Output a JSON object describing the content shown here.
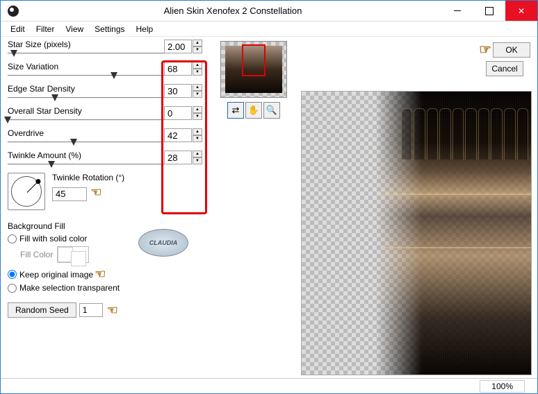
{
  "window": {
    "title": "Alien Skin Xenofex 2 Constellation"
  },
  "menu": {
    "edit": "Edit",
    "filter": "Filter",
    "view": "View",
    "settings": "Settings",
    "help": "Help"
  },
  "params": {
    "star_size": {
      "label": "Star Size (pixels)",
      "value": "2.00",
      "pos": 4
    },
    "size_var": {
      "label": "Size Variation",
      "value": "68",
      "pos": 68
    },
    "edge_density": {
      "label": "Edge Star Density",
      "value": "30",
      "pos": 30
    },
    "overall_density": {
      "label": "Overall Star Density",
      "value": "0",
      "pos": 0
    },
    "overdrive": {
      "label": "Overdrive",
      "value": "42",
      "pos": 42
    },
    "twinkle_amount": {
      "label": "Twinkle Amount (%)",
      "value": "28",
      "pos": 28
    }
  },
  "twinkle_rotation": {
    "label": "Twinkle Rotation (°)",
    "value": "45"
  },
  "badge": "CLAUDIA",
  "bgfill": {
    "group": "Background Fill",
    "solid": "Fill with solid color",
    "fillcolor": "Fill Color",
    "keep": "Keep original image",
    "trans": "Make selection transparent"
  },
  "seed": {
    "button": "Random Seed",
    "value": "1"
  },
  "tools": {
    "swap": "↻",
    "hand": "✋",
    "zoom": "🔍"
  },
  "buttons": {
    "ok": "OK",
    "cancel": "Cancel"
  },
  "status": {
    "zoom": "100%"
  }
}
